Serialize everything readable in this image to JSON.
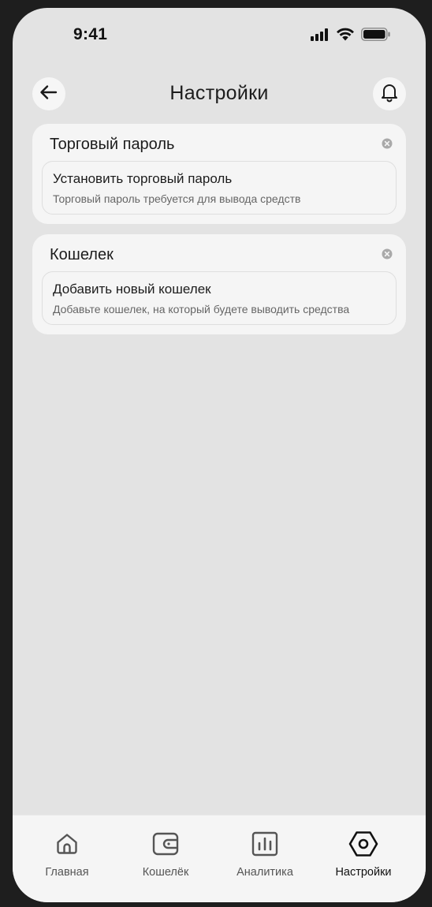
{
  "status_bar": {
    "time": "9:41",
    "icons": [
      "signal-icon",
      "wifi-icon",
      "battery-icon"
    ]
  },
  "header": {
    "title": "Настройки",
    "back_icon": "arrow-left-icon",
    "bell_icon": "bell-icon"
  },
  "cards": [
    {
      "title": "Торговый пароль",
      "item_title": "Установить торговый пароль",
      "item_subtitle": "Торговый пароль требуется для вывода средств"
    },
    {
      "title": "Кошелек",
      "item_title": "Добавить новый кошелек",
      "item_subtitle": "Добавьте кошелек, на который будете выводить средства"
    }
  ],
  "nav": {
    "items": [
      {
        "label": "Главная",
        "icon": "home-icon",
        "active": false
      },
      {
        "label": "Кошелёк",
        "icon": "wallet-icon",
        "active": false
      },
      {
        "label": "Аналитика",
        "icon": "chart-icon",
        "active": false
      },
      {
        "label": "Настройки",
        "icon": "hexagon-settings-icon",
        "active": true
      }
    ]
  },
  "colors": {
    "background": "#e3e3e3",
    "card": "#f5f5f5",
    "text": "#1c1c1c",
    "muted": "#666666"
  }
}
